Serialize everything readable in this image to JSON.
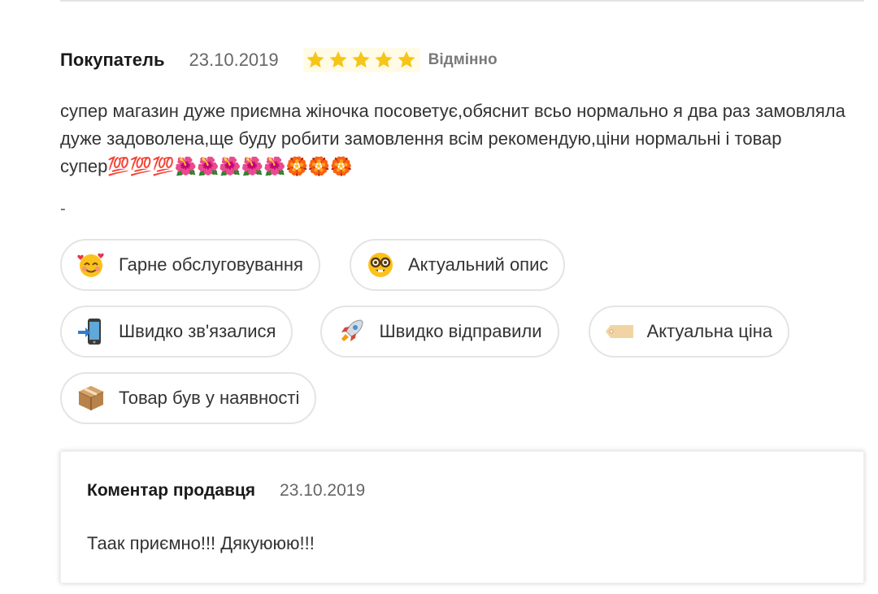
{
  "review": {
    "author": "Покупатель",
    "date": "23.10.2019",
    "rating": 5,
    "rating_max": 5,
    "rating_label": "Відмінно",
    "text": "супер магазин дуже приємна жіночка посоветує,обяснит всьо нормально я два раз замовляла дуже задоволена,ще буду робити замовлення всім рекомендую,ціни нормальні і товар супер💯💯💯🌺🌺🌺🌺🌺🏵️🏵️🏵️",
    "separator": "-"
  },
  "tags": [
    {
      "label": "Гарне обслуговування",
      "icon": "smiling-face-with-hearts-icon"
    },
    {
      "label": "Актуальний опис",
      "icon": "nerd-face-icon"
    },
    {
      "label": "Швидко зв'язалися",
      "icon": "mobile-phone-arrow-icon"
    },
    {
      "label": "Швидко відправили",
      "icon": "rocket-icon"
    },
    {
      "label": "Актуальна ціна",
      "icon": "price-tag-icon"
    },
    {
      "label": "Товар був у наявності",
      "icon": "package-box-icon"
    }
  ],
  "seller_comment": {
    "title": "Коментар продавця",
    "date": "23.10.2019",
    "text": "Таак приємно!!! Дякуююю!!!"
  },
  "colors": {
    "star": "#f5c518",
    "tag_border": "#e4e4e4",
    "text": "#333333"
  }
}
